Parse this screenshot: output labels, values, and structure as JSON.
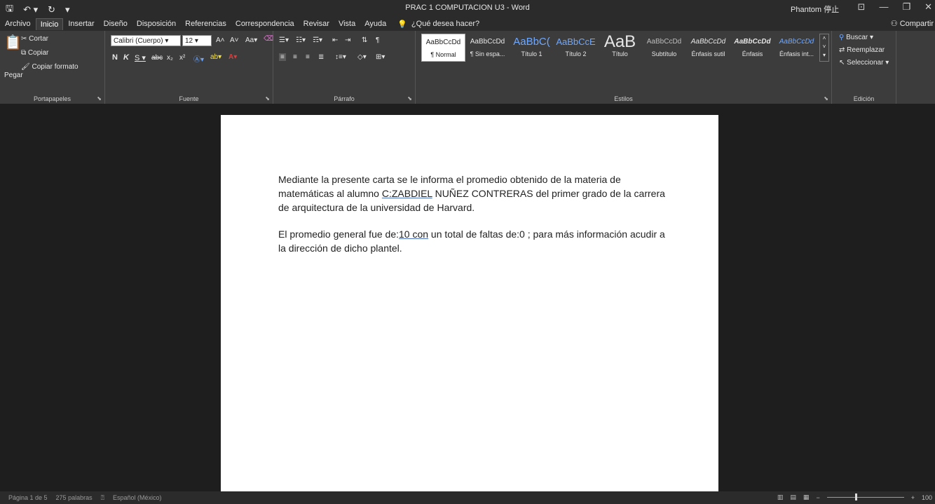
{
  "window": {
    "title": "PRAC 1 COMPUTACION U3 - Word",
    "user": "Phantom 停止",
    "controls": [
      "⊡",
      "—",
      "❐",
      "✕"
    ]
  },
  "qat": {
    "save": "🖫",
    "undo": "↶ ▾",
    "redo": "↻",
    "customize": "▾"
  },
  "tabs": [
    "Archivo",
    "Inicio",
    "Insertar",
    "Diseño",
    "Disposición",
    "Referencias",
    "Correspondencia",
    "Revisar",
    "Vista",
    "Ayuda"
  ],
  "active_tab": "Inicio",
  "tell_me": "¿Qué desea hacer?",
  "share": "Compartir",
  "clipboard": {
    "label": "Portapapeles",
    "paste": "Pegar",
    "cut": "Cortar",
    "copy": "Copiar",
    "format_painter": "Copiar formato"
  },
  "font": {
    "label": "Fuente",
    "family": "Calibri (Cuerpo)",
    "size": "12"
  },
  "paragraph": {
    "label": "Párrafo"
  },
  "styles": {
    "label": "Estilos",
    "items": [
      {
        "sample": "AaBbCcDd",
        "name": "¶ Normal"
      },
      {
        "sample": "AaBbCcDd",
        "name": "¶ Sin espa..."
      },
      {
        "sample": "AaBbC(",
        "name": "Título 1"
      },
      {
        "sample": "AaBbCcE",
        "name": "Título 2"
      },
      {
        "sample": "AaB",
        "name": "Título"
      },
      {
        "sample": "AaBbCcDd",
        "name": "Subtítulo"
      },
      {
        "sample": "AaBbCcDd",
        "name": "Énfasis sutil"
      },
      {
        "sample": "AaBbCcDd",
        "name": "Énfasis"
      },
      {
        "sample": "AaBbCcDd",
        "name": "Énfasis int..."
      }
    ]
  },
  "editing": {
    "label": "Edición",
    "find": "Buscar",
    "replace": "Reemplazar",
    "select": "Seleccionar"
  },
  "document": {
    "p1": {
      "before": "Mediante la presente carta se le informa el promedio obtenido de la materia de matemáticas al alumno ",
      "name_underlined": "C:ZABDIEL",
      "after": " NUÑEZ CONTRERAS del primer grado de la carrera de arquitectura de la universidad de Harvard."
    },
    "p2": {
      "before": "El promedio general fue de:",
      "grade_underlined": "10  con",
      "after": " un total de faltas de:0 ; para más información acudir a la dirección de dicho plantel."
    }
  },
  "status": {
    "page": "Página 1 de 5",
    "words": "275 palabras",
    "language": "Español (México)",
    "zoom": "100"
  }
}
